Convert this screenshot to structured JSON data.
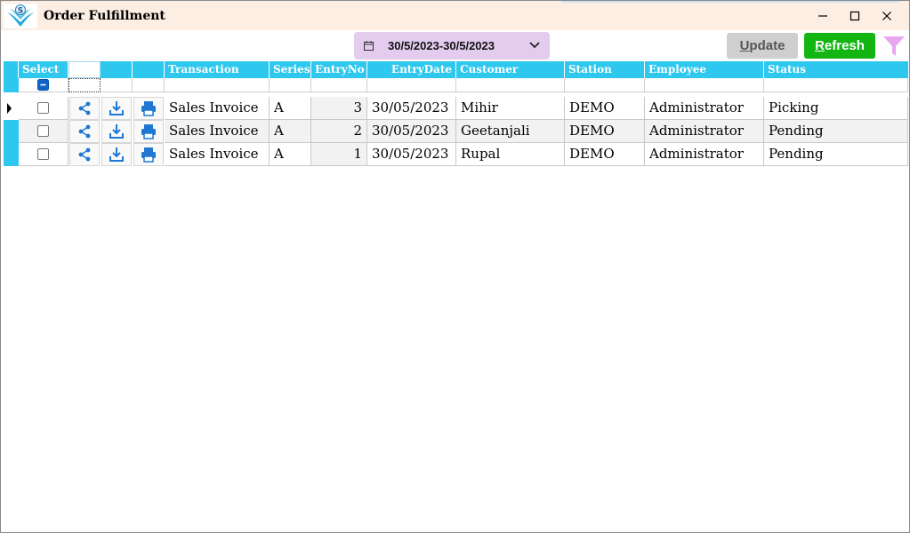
{
  "window": {
    "title": "Order Fulfillment"
  },
  "toolbar": {
    "date_range": "30/5/2023-30/5/2023",
    "update_label": "pdate",
    "update_accel": "U",
    "refresh_label": "efresh",
    "refresh_accel": "R"
  },
  "colors": {
    "header": "#2ec7ee",
    "refresh": "#12b512",
    "update": "#cfcfcf",
    "date_bg": "#e4ccee",
    "title_bg": "#fdeee3",
    "icon_blue": "#1e78d2",
    "filter": "#e7a6ef"
  },
  "grid": {
    "columns": {
      "select": "Select",
      "transaction": "Transaction",
      "series": "Series",
      "entryno": "EntryNo",
      "entrydate": "EntryDate",
      "customer": "Customer",
      "station": "Station",
      "employee": "Employee",
      "status": "Status"
    },
    "rows": [
      {
        "transaction": "Sales Invoice",
        "series": "A",
        "entryno": "3",
        "entrydate": "30/05/2023",
        "customer": "Mihir",
        "station": "DEMO",
        "employee": "Administrator",
        "status": "Picking"
      },
      {
        "transaction": "Sales Invoice",
        "series": "A",
        "entryno": "2",
        "entrydate": "30/05/2023",
        "customer": "Geetanjali",
        "station": "DEMO",
        "employee": "Administrator",
        "status": "Pending"
      },
      {
        "transaction": "Sales Invoice",
        "series": "A",
        "entryno": "1",
        "entrydate": "30/05/2023",
        "customer": "Rupal",
        "station": "DEMO",
        "employee": "Administrator",
        "status": "Pending"
      }
    ]
  },
  "icons": {
    "share": "share-icon",
    "download": "download-icon",
    "print": "print-icon",
    "filter": "filter-icon",
    "calendar": "calendar-icon"
  }
}
